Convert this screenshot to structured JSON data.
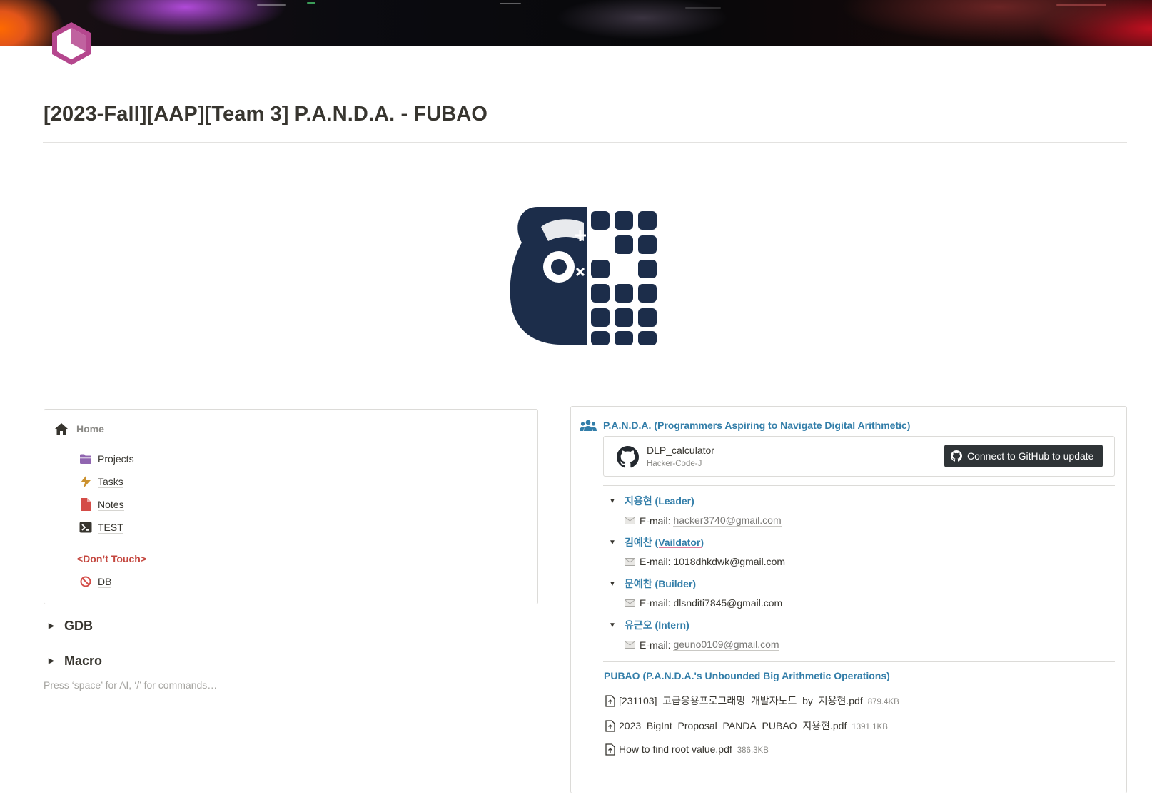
{
  "page": {
    "title": "[2023-Fall][AAP][Team 3] P.A.N.D.A. - FUBAO"
  },
  "colors": {
    "accent_blue": "#337ea9",
    "accent_red": "#c4473f",
    "page_icon": "#b5478e",
    "logo": "#1c2d4a"
  },
  "nav": {
    "home_label": "Home",
    "items": [
      {
        "label": "Projects",
        "icon": "folder-icon"
      },
      {
        "label": "Tasks",
        "icon": "bolt-icon"
      },
      {
        "label": "Notes",
        "icon": "document-icon"
      },
      {
        "label": "TEST",
        "icon": "terminal-icon"
      }
    ],
    "dont_touch_label": "<Don’t Touch>",
    "db_label": "DB"
  },
  "toggles": {
    "gdb": "GDB",
    "macro": "Macro"
  },
  "editor": {
    "placeholder": "Press ‘space’ for AI, ‘/’ for commands…"
  },
  "team": {
    "title": "P.A.N.D.A. (Programmers Aspiring to Navigate Digital Arithmetic)",
    "github": {
      "repo": "DLP_calculator",
      "owner": "Hacker-Code-J",
      "button": "Connect to GitHub to update"
    },
    "members": [
      {
        "name": "지용현 (Leader)",
        "email_label": "E-mail:",
        "email": "hacker3740@gmail.com"
      },
      {
        "name": "김예찬 (Vaildator)",
        "email_label": "E-mail:",
        "email": "1018dhkdwk@gmail.com"
      },
      {
        "name": "문예찬 (Builder)",
        "email_label": "E-mail:",
        "email": "dlsnditi7845@gmail.com"
      },
      {
        "name": "유근오 (Intern)",
        "email_label": "E-mail:",
        "email": "geuno0109@gmail.com"
      }
    ]
  },
  "pubao": {
    "title": "PUBAO (P.A.N.D.A.'s Unbounded Big Arithmetic Operations)",
    "files": [
      {
        "name": "[231103]_고급응용프로그래밍_개발자노트_by_지용현.pdf",
        "size": "879.4KB"
      },
      {
        "name": "2023_BigInt_Proposal_PANDA_PUBAO_지용현.pdf",
        "size": "1391.1KB"
      },
      {
        "name": "How to find root value.pdf",
        "size": "386.3KB"
      }
    ]
  }
}
